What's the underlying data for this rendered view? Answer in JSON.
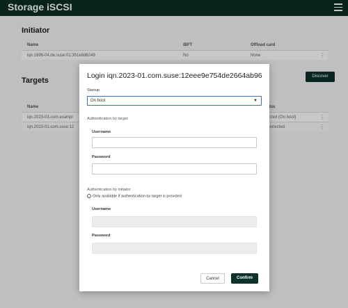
{
  "app": {
    "title": "Storage iSCSI",
    "menu_icon": "hamburger-menu-icon"
  },
  "initiator": {
    "title": "Initiator",
    "columns": [
      "Name",
      "iBFT",
      "Offload card"
    ],
    "rows": [
      {
        "name": "iqn.1996-04.de.suse:01:351e6d6249",
        "ibft": "No",
        "offload": "None"
      }
    ]
  },
  "targets": {
    "title": "Targets",
    "discover_label": "Discover",
    "columns": [
      "Name",
      "Status"
    ],
    "rows": [
      {
        "name": "iqn.2023-03.com.exampl",
        "status": "nnected (On boot)"
      },
      {
        "name": "iqn.2023-01.com.suse:12",
        "status": "isconnected"
      }
    ]
  },
  "modal": {
    "title": "Login iqn.2023-01.com.suse:12eee9e754de2664ab96",
    "startup_label": "Startup",
    "startup_value": "On boot",
    "auth_target_label": "Authentication by target",
    "username_label": "Username",
    "password_label": "Password",
    "auth_initiator_label": "Authentication by initiator",
    "initiator_hint": "Only available if authentication by target is provided",
    "username2_label": "Username",
    "password2_label": "Password",
    "cancel_label": "Cancel",
    "confirm_label": "Confirm"
  }
}
